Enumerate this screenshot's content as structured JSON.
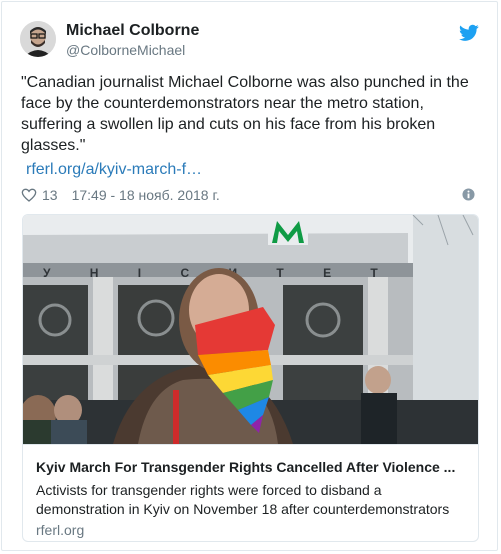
{
  "author": {
    "name": "Michael Colborne",
    "handle": "@ColborneMichael"
  },
  "tweet": {
    "text": "\"Canadian journalist Michael Colborne was also punched in the face by the counterdemonstrators near the metro station, suffering a swollen lip and cuts on his face from his broken glasses.\"",
    "link": "rferl.org/a/kyiv-march-f…",
    "likes": "13",
    "timestamp": "17:49 - 18 нояб. 2018 г."
  },
  "card": {
    "title": "Kyiv March For Transgender Rights Cancelled After Violence ...",
    "description": "Activists for transgender rights were forced to disband a demonstration in Kyiv on November 18 after counterdemonstrators",
    "domain": "rferl.org",
    "sign_letters": "У Н І   С И Т Е Т"
  },
  "icons": {
    "twitter": "twitter-bird-icon",
    "like": "heart-icon",
    "info": "info-icon"
  },
  "colors": {
    "twitter_blue": "#1da1f2",
    "link_blue": "#2b7bb9",
    "muted": "#697882",
    "metro_green": "#0f9b45"
  }
}
